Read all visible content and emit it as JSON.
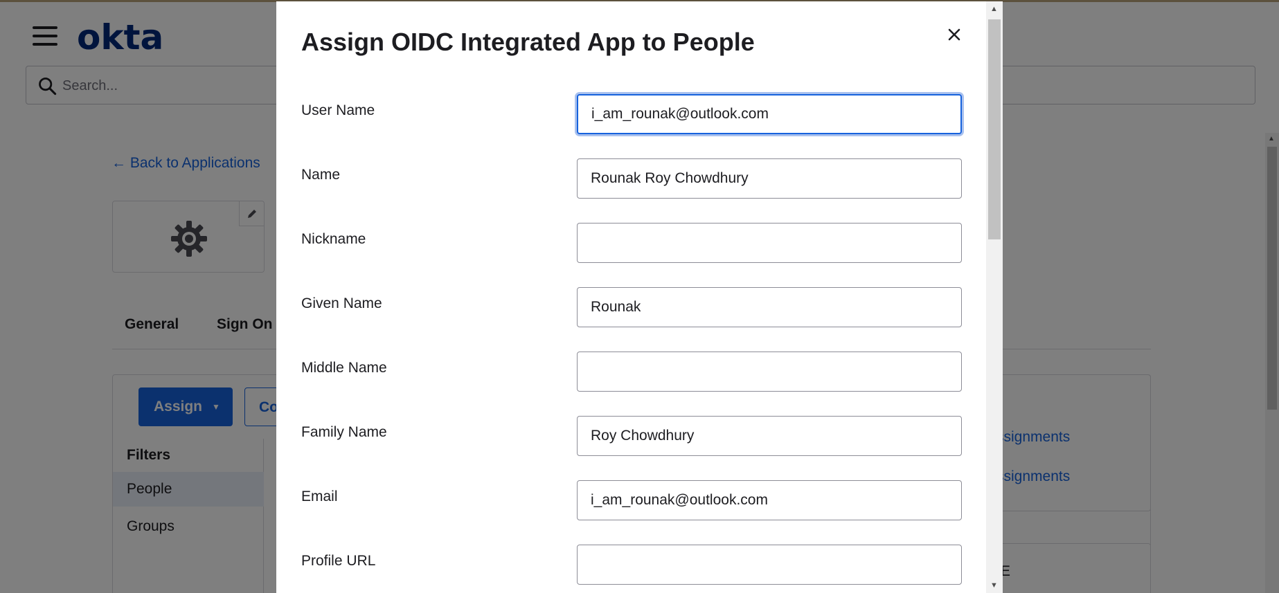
{
  "background": {
    "logo": "okta",
    "search_placeholder": "Search...",
    "back_link": "← Back to Applications",
    "tabs": [
      "General",
      "Sign On"
    ],
    "assign_label": "Assign",
    "convert_label": "Co",
    "filters_heading": "Filters",
    "filters": [
      "People",
      "Groups"
    ],
    "right_links": [
      "ssignments",
      "ssignments"
    ],
    "right_panel2_text": "E"
  },
  "modal": {
    "title": "Assign OIDC Integrated App to People",
    "close_icon": "close-icon",
    "fields": [
      {
        "label": "User Name",
        "value": "i_am_rounak@outlook.com",
        "focused": true
      },
      {
        "label": "Name",
        "value": "Rounak Roy Chowdhury"
      },
      {
        "label": "Nickname",
        "value": ""
      },
      {
        "label": "Given Name",
        "value": "Rounak"
      },
      {
        "label": "Middle Name",
        "value": ""
      },
      {
        "label": "Family Name",
        "value": "Roy Chowdhury"
      },
      {
        "label": "Email",
        "value": "i_am_rounak@outlook.com"
      },
      {
        "label": "Profile URL",
        "value": ""
      }
    ]
  },
  "colors": {
    "brand": "#00297a",
    "accent": "#1662dd",
    "overlay": "rgba(0,0,0,0.5)"
  }
}
